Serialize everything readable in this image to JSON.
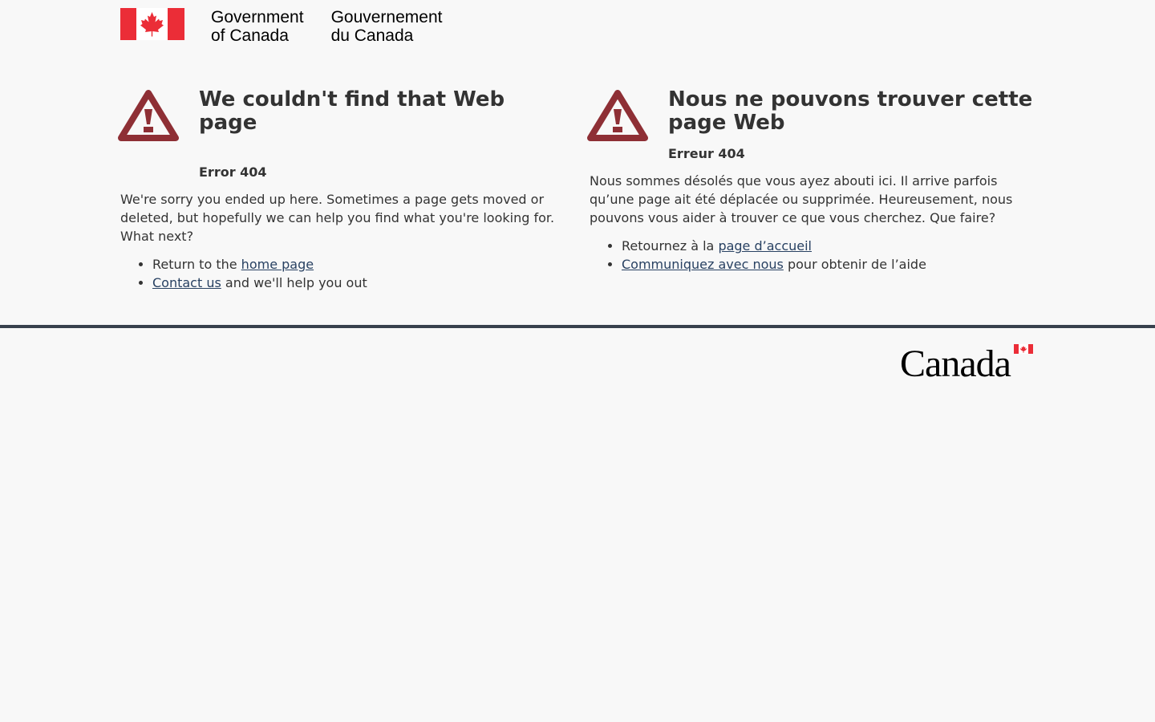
{
  "header": {
    "signature_en": [
      "Government",
      "of Canada"
    ],
    "signature_fr": [
      "Gouvernement",
      "du Canada"
    ]
  },
  "english": {
    "title": "We couldn't find that Web page",
    "error": "Error 404",
    "message": "We're sorry you ended up here. Sometimes a page gets moved or deleted, but hopefully we can help you find what you're looking for. What next?",
    "item1_prefix": "Return to the ",
    "item1_link": "home page",
    "item2_link": "Contact us",
    "item2_suffix": " and we'll help you out"
  },
  "french": {
    "title": "Nous ne pouvons trouver cette page Web",
    "error": "Erreur 404",
    "message": "Nous sommes désolés que vous ayez abouti ici. Il arrive parfois qu’une page ait été déplacée ou supprimée. Heureusement, nous pouvons vous aider à trouver ce que vous cherchez. Que faire?",
    "item1_prefix": "Retournez à la ",
    "item1_link": "page d’accueil",
    "item2_link": "Communiquez avec nous",
    "item2_suffix": " pour obtenir de l’aide"
  },
  "footer": {
    "wordmark": "Canada"
  },
  "icons": {
    "flag": "canada-flag-icon",
    "warning": "warning-triangle-icon"
  },
  "colors": {
    "flag_red": "#eb2d37",
    "warning_red": "#8e2f35",
    "link": "#284162",
    "footer_border": "#38414d",
    "background": "#f8f8f8"
  }
}
